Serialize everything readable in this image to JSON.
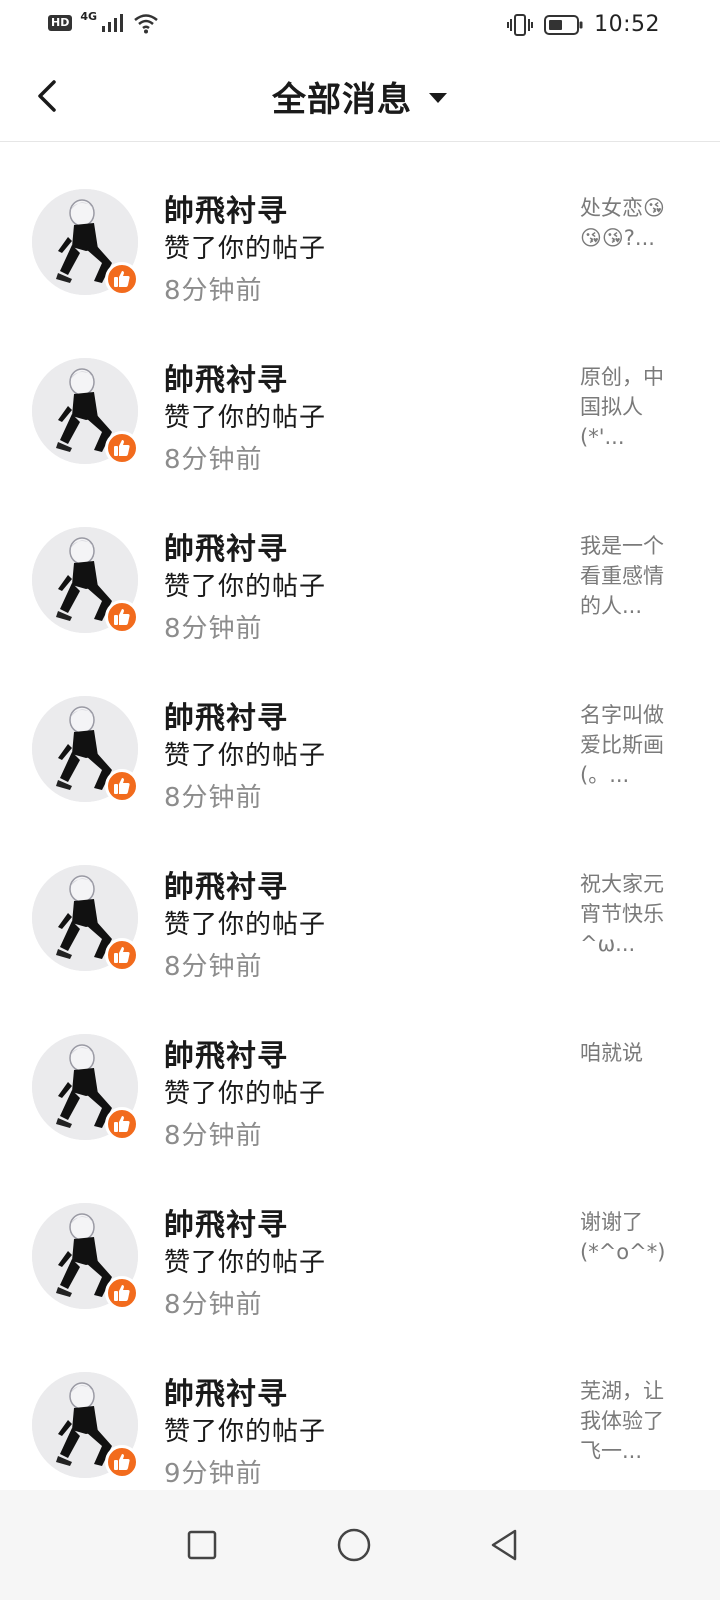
{
  "status_bar": {
    "hd": "HD",
    "network": "4G",
    "time": "10:52",
    "icons": [
      "signal-icon",
      "wifi-icon",
      "vibrate-icon",
      "battery-icon"
    ]
  },
  "header": {
    "title": "全部消息",
    "back_icon": "chevron-left-icon",
    "dropdown_icon": "caret-down-icon"
  },
  "messages": [
    {
      "user": "帥飛衬寻",
      "action": "赞了你的帖子",
      "time": "8分钟前",
      "preview": "处女恋😘\n😘😘?..."
    },
    {
      "user": "帥飛衬寻",
      "action": "赞了你的帖子",
      "time": "8分钟前",
      "preview": "原创，中\n国拟人\n(*'..."
    },
    {
      "user": "帥飛衬寻",
      "action": "赞了你的帖子",
      "time": "8分钟前",
      "preview": "我是一个\n看重感情\n的人..."
    },
    {
      "user": "帥飛衬寻",
      "action": "赞了你的帖子",
      "time": "8分钟前",
      "preview": "名字叫做\n爱比斯画\n(。..."
    },
    {
      "user": "帥飛衬寻",
      "action": "赞了你的帖子",
      "time": "8分钟前",
      "preview": "祝大家元\n宵节快乐\n^ω..."
    },
    {
      "user": "帥飛衬寻",
      "action": "赞了你的帖子",
      "time": "8分钟前",
      "preview": "咱就说"
    },
    {
      "user": "帥飛衬寻",
      "action": "赞了你的帖子",
      "time": "8分钟前",
      "preview": "谢谢了\n(*^o^*)"
    },
    {
      "user": "帥飛衬寻",
      "action": "赞了你的帖子",
      "time": "9分钟前",
      "preview": "芜湖，让\n我体验了\n飞一..."
    }
  ],
  "colors": {
    "like_badge": "#f26b1d",
    "time_text": "#8c8c8c",
    "preview_text": "#7a7a7a"
  },
  "nav_bar": {
    "icons": [
      "recents-square-icon",
      "home-circle-icon",
      "back-triangle-icon"
    ]
  }
}
